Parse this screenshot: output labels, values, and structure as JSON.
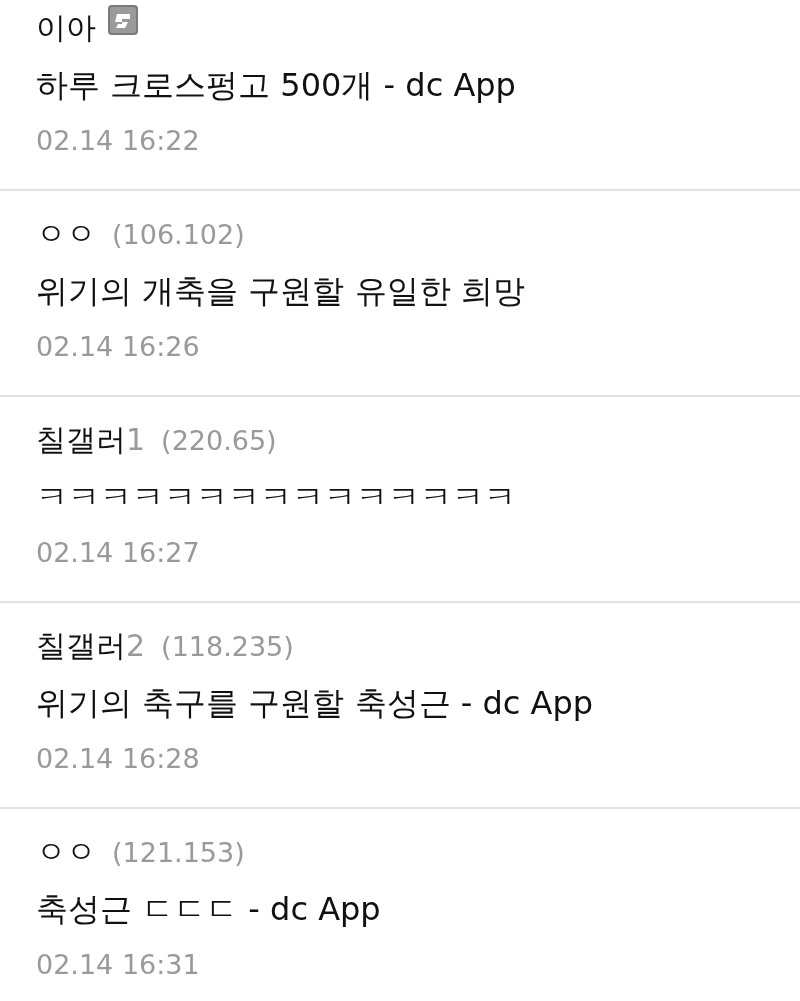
{
  "comments": [
    {
      "name": "이아",
      "member_icon": true,
      "text": "하루 크로스펑고 500개 - dc App",
      "time": "02.14 16:22"
    },
    {
      "name": "ㅇㅇ",
      "member_icon": false,
      "ip": "(106.102)",
      "text": "위기의 개축을 구원할 유일한 희망",
      "time": "02.14 16:26"
    },
    {
      "name": "칠갤러",
      "suffix": "1",
      "member_icon": false,
      "ip": "(220.65)",
      "text": "ㅋㅋㅋㅋㅋㅋㅋㅋㅋㅋㅋㅋㅋㅋㅋ",
      "time": "02.14 16:27"
    },
    {
      "name": "칠갤러",
      "suffix": "2",
      "member_icon": false,
      "ip": "(118.235)",
      "text": "위기의 축구를 구원할 축성근 - dc App",
      "time": "02.14 16:28"
    },
    {
      "name": "ㅇㅇ",
      "member_icon": false,
      "ip": "(121.153)",
      "text": "축성근 ㄷㄷㄷ - dc App",
      "time": "02.14 16:31"
    }
  ]
}
